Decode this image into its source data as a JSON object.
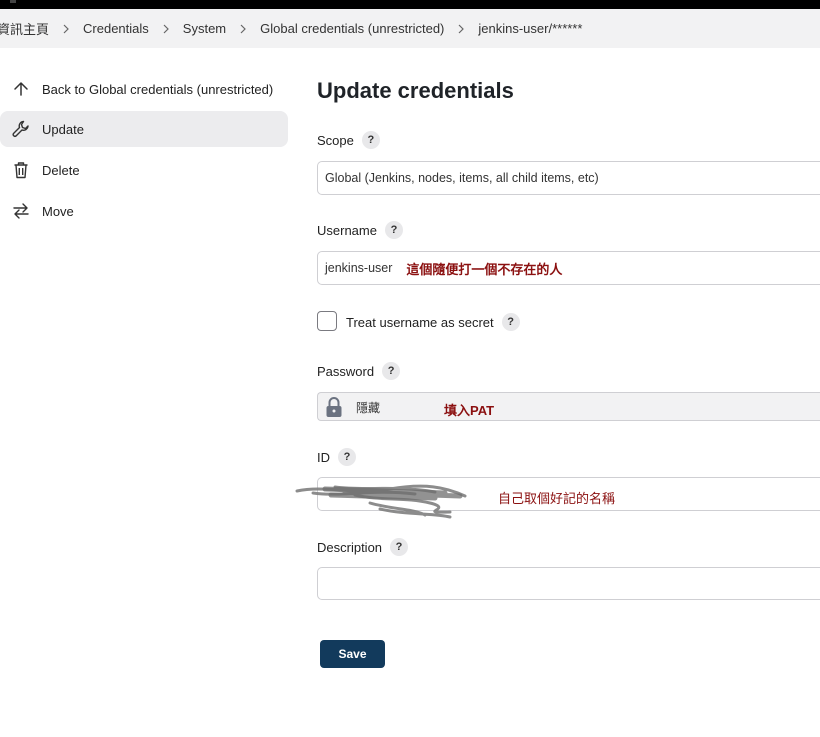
{
  "breadcrumb": [
    "資訊主頁",
    "Credentials",
    "System",
    "Global credentials (unrestricted)",
    "jenkins-user/******"
  ],
  "sidebar": {
    "items": [
      {
        "label": "Back to Global credentials (unrestricted)",
        "icon": "arrow-up-icon"
      },
      {
        "label": "Update",
        "icon": "wrench-icon",
        "active": true
      },
      {
        "label": "Delete",
        "icon": "trash-icon"
      },
      {
        "label": "Move",
        "icon": "swap-arrows-icon"
      }
    ]
  },
  "form": {
    "title": "Update credentials",
    "help": "?",
    "scope": {
      "label": "Scope",
      "value": "Global (Jenkins, nodes, items, all child items, etc)"
    },
    "username": {
      "label": "Username",
      "value": "jenkins-user",
      "note": "這個隨便打一個不存在的人"
    },
    "treat_secret": {
      "label": "Treat username as secret",
      "checked": false
    },
    "password": {
      "label": "Password",
      "value": "隱藏",
      "note": "填入PAT"
    },
    "id": {
      "label": "ID",
      "value": "",
      "note": "自己取個好記的名稱"
    },
    "description": {
      "label": "Description",
      "value": ""
    },
    "save_label": "Save"
  },
  "colors": {
    "primary": "#123a5c",
    "note": "#8b1010",
    "active_bg": "#ececee",
    "breadcrumb_bg": "#f2f2f3"
  }
}
